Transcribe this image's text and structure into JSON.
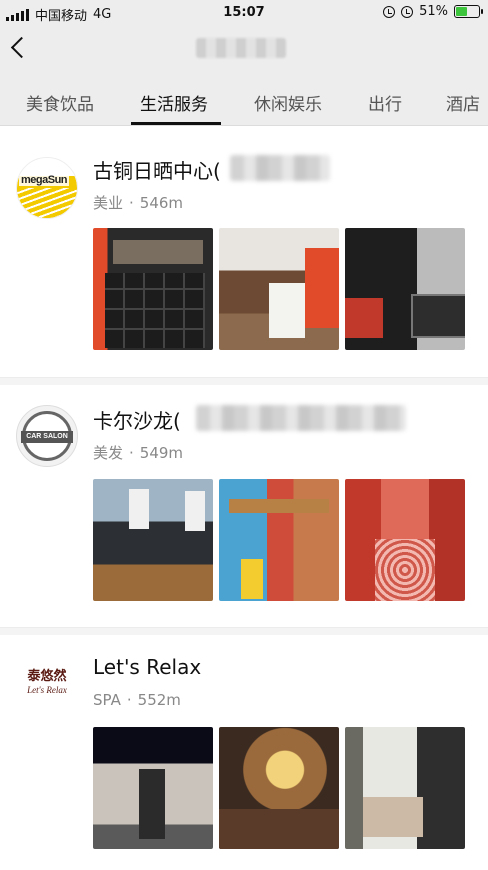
{
  "status_bar": {
    "carrier": "中国移动",
    "network": "4G",
    "time": "15:07",
    "battery": "51%",
    "battery_level": 0.51
  },
  "tabs": [
    {
      "label": "美食饮品",
      "active": false
    },
    {
      "label": "生活服务",
      "active": true
    },
    {
      "label": "休闲娱乐",
      "active": false
    },
    {
      "label": "出行",
      "active": false
    },
    {
      "label": "酒店",
      "active": false
    }
  ],
  "places": [
    {
      "name": "古铜日晒中心(",
      "category": "美业",
      "distance": "546m",
      "logo_text": "megaSun"
    },
    {
      "name": "卡尔沙龙(",
      "category": "美发",
      "distance": "549m",
      "logo_text": "CAR SALON"
    },
    {
      "name": "Let's Relax",
      "category": "SPA",
      "distance": "552m",
      "logo_text_cn": "泰悠然",
      "logo_text_en": "Let's Relax"
    }
  ],
  "separator": "·",
  "colors": {
    "background": "#ededed",
    "text_primary": "#111111",
    "text_secondary": "#888888",
    "battery_fill": "#3cc43c"
  }
}
